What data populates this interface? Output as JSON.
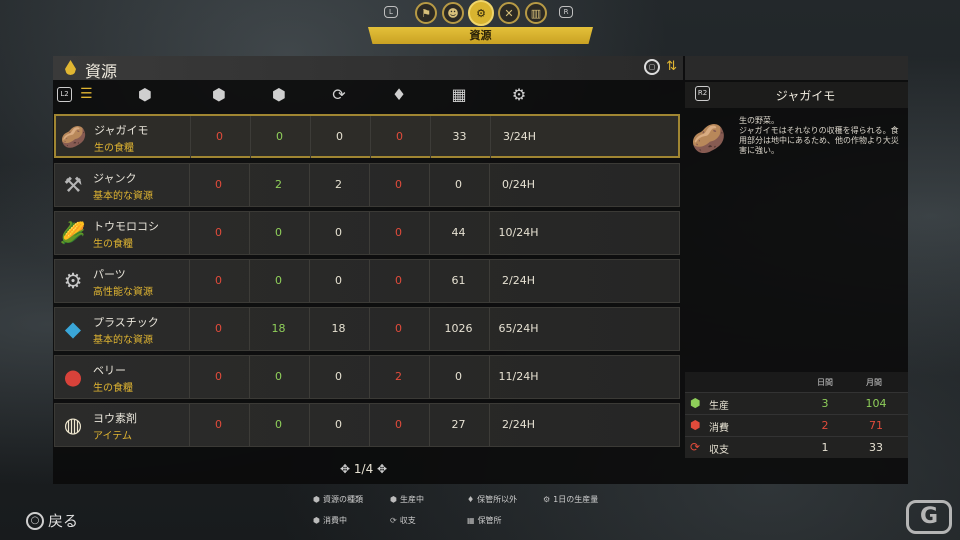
{
  "nav": {
    "bumper_left": "L",
    "bumper_right": "R",
    "tabs": [
      {
        "icon": "banner-icon",
        "glyph": "⚑"
      },
      {
        "icon": "people-icon",
        "glyph": "☻"
      },
      {
        "icon": "resource-icon",
        "glyph": "⚙"
      },
      {
        "icon": "tools-icon",
        "glyph": "✕"
      },
      {
        "icon": "chart-icon",
        "glyph": "▥"
      }
    ],
    "active_tab_label": "資源"
  },
  "panel": {
    "title": "資源",
    "list_button": "L2",
    "detail_button": "R2"
  },
  "columns": [
    {
      "icon": "resource-type-icon",
      "glyph": "⬢"
    },
    {
      "icon": "consumption-icon",
      "glyph": "⬢"
    },
    {
      "icon": "production-icon",
      "glyph": "⬢"
    },
    {
      "icon": "conversion-icon",
      "glyph": "⟳"
    },
    {
      "icon": "non-storage-icon",
      "glyph": "♦"
    },
    {
      "icon": "storage-icon",
      "glyph": "▦"
    },
    {
      "icon": "daily-production-icon",
      "glyph": "⚙"
    }
  ],
  "rows": [
    {
      "name": "ジャガイモ",
      "category": "生の食糧",
      "icon": "potato-icon",
      "glyph": "🥔",
      "c1": "0",
      "c2": "0",
      "c3": "0",
      "c4": "0",
      "c5": "33",
      "c6": "3/24H",
      "c2cls": "green",
      "c3cls": "white",
      "c4cls": "red",
      "selected": true
    },
    {
      "name": "ジャンク",
      "category": "基本的な資源",
      "icon": "junk-icon",
      "glyph": "⚒",
      "c1": "0",
      "c2": "2",
      "c3": "2",
      "c4": "0",
      "c5": "0",
      "c6": "0/24H",
      "c2cls": "green",
      "c3cls": "white",
      "c4cls": "red",
      "selected": false
    },
    {
      "name": "トウモロコシ",
      "category": "生の食糧",
      "icon": "corn-icon",
      "glyph": "🌽",
      "c1": "0",
      "c2": "0",
      "c3": "0",
      "c4": "0",
      "c5": "44",
      "c6": "10/24H",
      "c2cls": "green",
      "c3cls": "white",
      "c4cls": "red",
      "selected": false
    },
    {
      "name": "パーツ",
      "category": "高性能な資源",
      "icon": "parts-icon",
      "glyph": "⚙",
      "c1": "0",
      "c2": "0",
      "c3": "0",
      "c4": "0",
      "c5": "61",
      "c6": "2/24H",
      "c2cls": "green",
      "c3cls": "white",
      "c4cls": "red",
      "selected": false
    },
    {
      "name": "プラスチック",
      "category": "基本的な資源",
      "icon": "plastic-icon",
      "glyph": "◆",
      "c1": "0",
      "c2": "18",
      "c3": "18",
      "c4": "0",
      "c5": "1026",
      "c6": "65/24H",
      "c2cls": "green",
      "c3cls": "white",
      "c4cls": "red",
      "selected": false
    },
    {
      "name": "ベリー",
      "category": "生の食糧",
      "icon": "berry-icon",
      "glyph": "●",
      "c1": "0",
      "c2": "0",
      "c3": "0",
      "c4": "2",
      "c5": "0",
      "c6": "11/24H",
      "c2cls": "green",
      "c3cls": "white",
      "c4cls": "red",
      "selected": false
    },
    {
      "name": "ヨウ素剤",
      "category": "アイテム",
      "icon": "iodine-icon",
      "glyph": "◍",
      "c1": "0",
      "c2": "0",
      "c3": "0",
      "c4": "0",
      "c5": "27",
      "c6": "2/24H",
      "c2cls": "green",
      "c3cls": "white",
      "c4cls": "red",
      "selected": false
    }
  ],
  "pager": {
    "text": "1/4"
  },
  "detail": {
    "name": "ジャガイモ",
    "description": "生の野菜。\nジャガイモはそれなりの収穫を得られる。食用部分は地中にあるため、他の作物より大災害に強い。",
    "stats_header": {
      "daily": "日間",
      "monthly": "月間"
    },
    "stats": [
      {
        "label": "生産",
        "daily": "3",
        "monthly": "104",
        "icon": "production-icon",
        "glyph": "⬢",
        "color": "#8fcf5a"
      },
      {
        "label": "消費",
        "daily": "2",
        "monthly": "71",
        "icon": "consumption-icon",
        "glyph": "⬢",
        "color": "#e14b3b"
      },
      {
        "label": "収支",
        "daily": "1",
        "monthly": "33",
        "icon": "balance-icon",
        "glyph": "⟳",
        "color": "#e14b3b"
      }
    ]
  },
  "footer": {
    "back_button": "○",
    "back_label": "戻る",
    "legend": [
      {
        "glyph": "⬢",
        "label": "資源の種類"
      },
      {
        "glyph": "⬢",
        "label": "生産中"
      },
      {
        "glyph": "♦",
        "label": "保管所以外"
      },
      {
        "glyph": "⚙",
        "label": "1日の生産量"
      },
      {
        "glyph": "⬢",
        "label": "消費中"
      },
      {
        "glyph": "⟳",
        "label": "収支"
      },
      {
        "glyph": "▦",
        "label": "保管所"
      }
    ],
    "logo": "G"
  }
}
